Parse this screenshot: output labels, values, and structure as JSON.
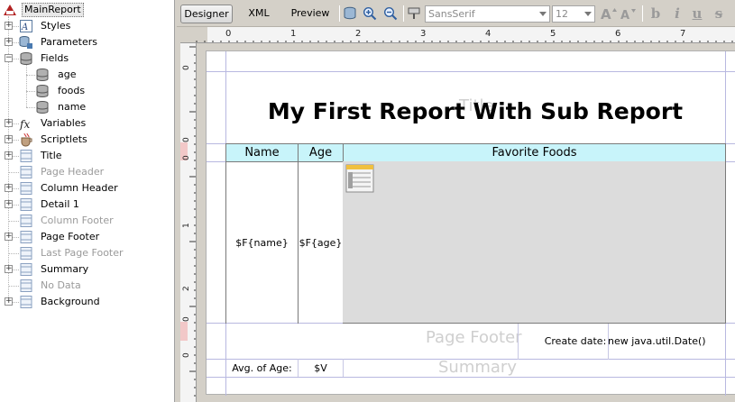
{
  "tree": {
    "root": "MainReport",
    "nodes": [
      {
        "id": "styles",
        "label": "Styles",
        "icon": "styles-icon",
        "dim": false
      },
      {
        "id": "parameters",
        "label": "Parameters",
        "icon": "parameters-icon",
        "dim": false
      },
      {
        "id": "fields",
        "label": "Fields",
        "icon": "fields-icon",
        "dim": false
      },
      {
        "id": "field-age",
        "label": "age",
        "icon": "field-icon",
        "dim": false
      },
      {
        "id": "field-foods",
        "label": "foods",
        "icon": "field-icon",
        "dim": false
      },
      {
        "id": "field-name",
        "label": "name",
        "icon": "field-icon",
        "dim": false
      },
      {
        "id": "variables",
        "label": "Variables",
        "icon": "variables-icon",
        "dim": false
      },
      {
        "id": "scriptlets",
        "label": "Scriptlets",
        "icon": "scriptlets-icon",
        "dim": false
      },
      {
        "id": "title",
        "label": "Title",
        "icon": "band-icon",
        "dim": false
      },
      {
        "id": "page-header",
        "label": "Page Header",
        "icon": "band-icon",
        "dim": true
      },
      {
        "id": "column-header",
        "label": "Column Header",
        "icon": "band-icon",
        "dim": false
      },
      {
        "id": "detail-1",
        "label": "Detail 1",
        "icon": "band-icon",
        "dim": false
      },
      {
        "id": "column-footer",
        "label": "Column Footer",
        "icon": "band-icon",
        "dim": true
      },
      {
        "id": "page-footer",
        "label": "Page Footer",
        "icon": "band-icon",
        "dim": false
      },
      {
        "id": "last-page-footer",
        "label": "Last Page Footer",
        "icon": "band-icon",
        "dim": true
      },
      {
        "id": "summary",
        "label": "Summary",
        "icon": "band-icon",
        "dim": false
      },
      {
        "id": "no-data",
        "label": "No Data",
        "icon": "band-icon",
        "dim": true
      },
      {
        "id": "background",
        "label": "Background",
        "icon": "band-icon",
        "dim": false
      }
    ]
  },
  "toolbar": {
    "tabs": [
      "Designer",
      "XML",
      "Preview"
    ],
    "active_tab": "Designer",
    "font_family": "SansSerif",
    "font_size": "12",
    "format_buttons": {
      "bold": "b",
      "italic": "i",
      "underline": "u",
      "strike": "s"
    }
  },
  "ruler": {
    "top_labels": [
      "0",
      "1",
      "2",
      "3",
      "4",
      "5",
      "6",
      "7"
    ],
    "left_labels": [
      "0",
      "0",
      "0",
      "1",
      "2",
      "0",
      "0"
    ]
  },
  "report": {
    "title": "My First Report With Sub Report",
    "title_watermark": "Title",
    "column_headers": [
      "Name",
      "Age",
      "Favorite Foods"
    ],
    "detail_name": "$F{name}",
    "detail_age": "$F{age}",
    "page_footer_watermark": "Page Footer",
    "create_date_label": "Create date:",
    "create_date_expr": "new java.util.Date()",
    "summary_watermark": "Summary",
    "avg_age_label": "Avg. of Age:",
    "avg_age_value": "$V"
  },
  "colors": {
    "header_bg": "#c8f4fa",
    "subreport_bg": "#dcdcdc",
    "guide_line": "#b8b8e0"
  }
}
